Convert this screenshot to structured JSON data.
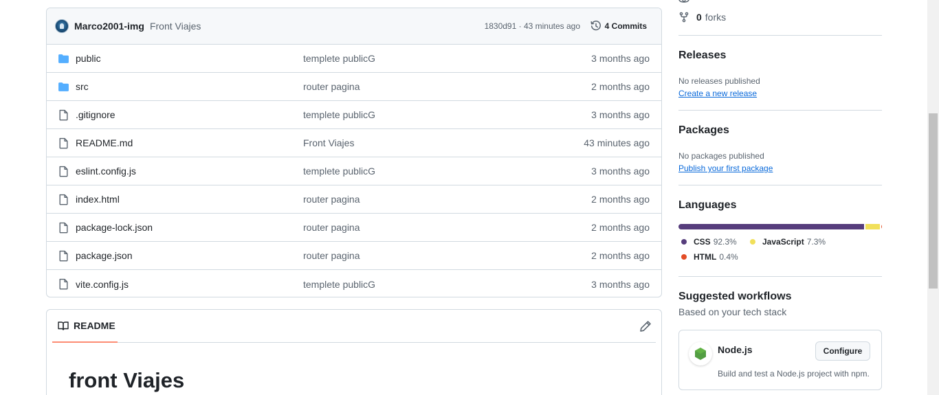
{
  "latest_commit": {
    "author": "Marco2001-img",
    "message": "Front Viajes",
    "meta": "1830d91 · 43 minutes ago",
    "commits_label": "4 Commits"
  },
  "files": [
    {
      "name": "public",
      "type": "folder",
      "commit": "templete publicG",
      "age": "3 months ago"
    },
    {
      "name": "src",
      "type": "folder",
      "commit": "router pagina",
      "age": "2 months ago"
    },
    {
      "name": ".gitignore",
      "type": "file",
      "commit": "templete publicG",
      "age": "3 months ago"
    },
    {
      "name": "README.md",
      "type": "file",
      "commit": "Front Viajes",
      "age": "43 minutes ago"
    },
    {
      "name": "eslint.config.js",
      "type": "file",
      "commit": "templete publicG",
      "age": "3 months ago"
    },
    {
      "name": "index.html",
      "type": "file",
      "commit": "router pagina",
      "age": "2 months ago"
    },
    {
      "name": "package-lock.json",
      "type": "file",
      "commit": "router pagina",
      "age": "2 months ago"
    },
    {
      "name": "package.json",
      "type": "file",
      "commit": "router pagina",
      "age": "2 months ago"
    },
    {
      "name": "vite.config.js",
      "type": "file",
      "commit": "templete publicG",
      "age": "3 months ago"
    }
  ],
  "readme": {
    "tab_label": "README",
    "title": "front Viajes"
  },
  "sidebar": {
    "forks_count": "0",
    "forks_label": "forks",
    "releases": {
      "heading": "Releases",
      "empty_text": "No releases published",
      "link": "Create a new release"
    },
    "packages": {
      "heading": "Packages",
      "empty_text": "No packages published",
      "link": "Publish your first package"
    },
    "languages": {
      "heading": "Languages",
      "items": [
        {
          "name": "CSS",
          "percent": "92.3%",
          "value": 92.3,
          "color": "#563d7c"
        },
        {
          "name": "JavaScript",
          "percent": "7.3%",
          "value": 7.3,
          "color": "#f1e05a"
        },
        {
          "name": "HTML",
          "percent": "0.4%",
          "value": 0.4,
          "color": "#e34c26"
        }
      ]
    },
    "workflows": {
      "heading": "Suggested workflows",
      "subheading": "Based on your tech stack",
      "card": {
        "name": "Node.js",
        "description": "Build and test a Node.js project with npm.",
        "button": "Configure"
      }
    }
  },
  "icons": {
    "folder": "folder-icon",
    "file": "file-icon",
    "history": "history-icon",
    "book": "book-icon",
    "pencil": "pencil-icon",
    "fork": "fork-icon",
    "nodejs": "nodejs-logo-icon"
  },
  "colors": {
    "folder": "#54aeff",
    "link": "#0969da",
    "tab_underline": "#fd8c73"
  }
}
